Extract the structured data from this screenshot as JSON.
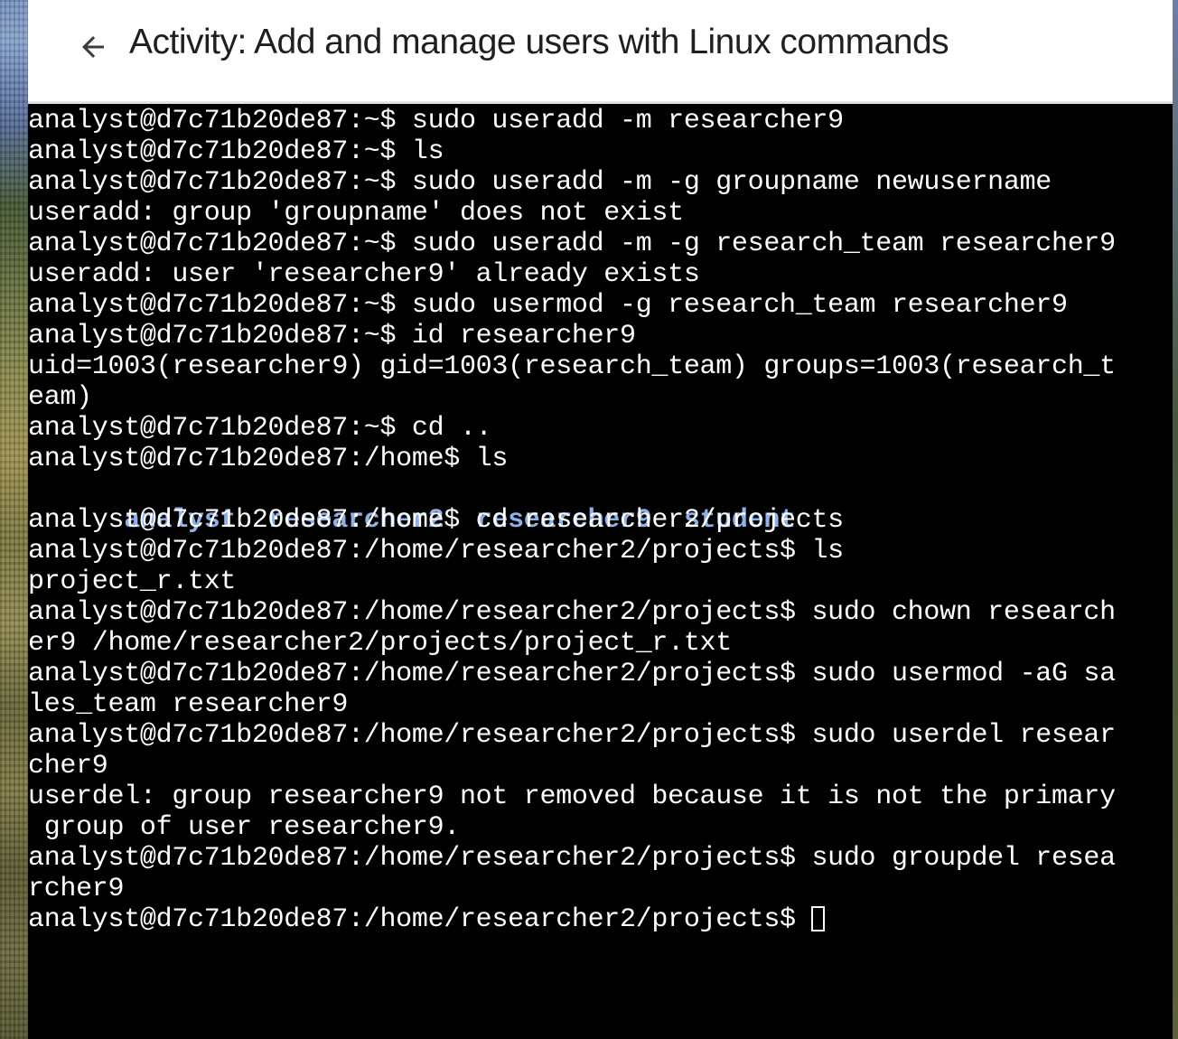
{
  "header": {
    "title": "Activity: Add and manage users with Linux commands",
    "back_icon": "arrow-left-icon"
  },
  "terminal": {
    "lines": [
      "analyst@d7c71b20de87:~$ sudo useradd -m researcher9",
      "analyst@d7c71b20de87:~$ ls",
      "analyst@d7c71b20de87:~$ sudo useradd -m -g groupname newusername",
      "useradd: group 'groupname' does not exist",
      "analyst@d7c71b20de87:~$ sudo useradd -m -g research_team researcher9",
      "useradd: user 'researcher9' already exists",
      "analyst@d7c71b20de87:~$ sudo usermod -g research_team researcher9",
      "analyst@d7c71b20de87:~$ id researcher9",
      "uid=1003(researcher9) gid=1003(research_team) groups=1003(research_t",
      "eam)",
      "analyst@d7c71b20de87:~$ cd ..",
      "analyst@d7c71b20de87:/home$ ls"
    ],
    "dir_listing": [
      "analyst",
      "researcher2",
      "researcher9",
      "student"
    ],
    "lines_after": [
      "analyst@d7c71b20de87:/home$ cd researcher2/projects",
      "analyst@d7c71b20de87:/home/researcher2/projects$ ls",
      "project_r.txt",
      "analyst@d7c71b20de87:/home/researcher2/projects$ sudo chown research",
      "er9 /home/researcher2/projects/project_r.txt",
      "analyst@d7c71b20de87:/home/researcher2/projects$ sudo usermod -aG sa",
      "les_team researcher9",
      "analyst@d7c71b20de87:/home/researcher2/projects$ sudo userdel resear",
      "cher9",
      "userdel: group researcher9 not removed because it is not the primary",
      " group of user researcher9.",
      "analyst@d7c71b20de87:/home/researcher2/projects$ sudo groupdel resea",
      "rcher9"
    ],
    "prompt": "analyst@d7c71b20de87:/home/researcher2/projects$ ",
    "text_color": "#ffffff",
    "dir_color": "#8fb1e8",
    "background": "#000000"
  }
}
